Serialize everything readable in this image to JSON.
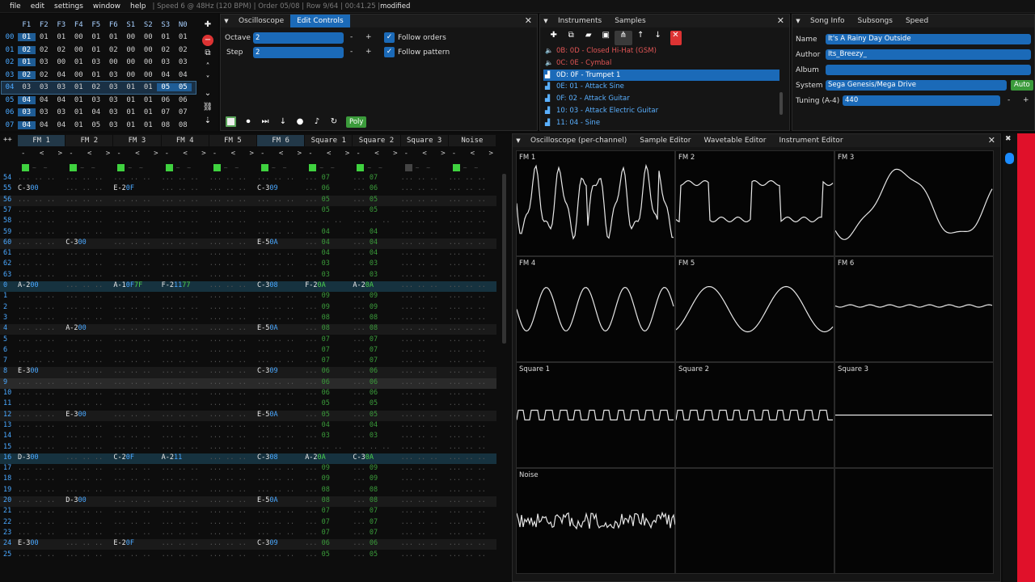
{
  "menu": {
    "file": "file",
    "edit": "edit",
    "settings": "settings",
    "window": "window",
    "help": "help",
    "status": "| Speed 6 @ 48Hz (120 BPM) | Order 05/08 | Row 9/64 | 00:41.25 |",
    "modified": "modified"
  },
  "orders": {
    "headers": [
      "F1",
      "F2",
      "F3",
      "F4",
      "F5",
      "F6",
      "S1",
      "S2",
      "S3",
      "N0"
    ],
    "rows": [
      {
        "n": "00",
        "v": [
          "01",
          "01",
          "01",
          "00",
          "01",
          "01",
          "00",
          "00",
          "01",
          "01"
        ]
      },
      {
        "n": "01",
        "v": [
          "02",
          "02",
          "02",
          "00",
          "01",
          "02",
          "00",
          "00",
          "02",
          "02"
        ]
      },
      {
        "n": "02",
        "v": [
          "01",
          "03",
          "00",
          "01",
          "03",
          "00",
          "00",
          "00",
          "03",
          "03"
        ]
      },
      {
        "n": "03",
        "v": [
          "02",
          "02",
          "04",
          "00",
          "01",
          "03",
          "00",
          "00",
          "04",
          "04"
        ]
      },
      {
        "n": "04",
        "v": [
          "03",
          "03",
          "03",
          "01",
          "02",
          "03",
          "01",
          "01",
          "05",
          "05"
        ]
      },
      {
        "n": "05",
        "v": [
          "04",
          "04",
          "04",
          "01",
          "03",
          "03",
          "01",
          "01",
          "06",
          "06"
        ]
      },
      {
        "n": "06",
        "v": [
          "03",
          "03",
          "03",
          "01",
          "04",
          "03",
          "01",
          "01",
          "07",
          "07"
        ]
      },
      {
        "n": "07",
        "v": [
          "04",
          "04",
          "04",
          "01",
          "05",
          "03",
          "01",
          "01",
          "08",
          "08"
        ]
      }
    ]
  },
  "edit": {
    "tab1": "Oscilloscope",
    "tab2": "Edit Controls",
    "octave_label": "Octave",
    "octave": "2",
    "step_label": "Step",
    "step": "2",
    "minus": "-",
    "plus": "+",
    "follow_orders": "Follow orders",
    "follow_pattern": "Follow pattern",
    "poly": "Poly"
  },
  "instruments": {
    "tab1": "Instruments",
    "tab2": "Samples",
    "items": [
      {
        "label": "0B: 0D - Closed Hi-Hat (GSM)",
        "kind": "red"
      },
      {
        "label": "0C: 0E - Cymbal",
        "kind": "red"
      },
      {
        "label": "0D: 0F - Trumpet 1",
        "kind": "sel"
      },
      {
        "label": "0E: 01 - Attack Sine",
        "kind": "blue"
      },
      {
        "label": "0F: 02 - Attack Guitar",
        "kind": "blue"
      },
      {
        "label": "10: 03 - Attack Electric Guitar",
        "kind": "blue"
      },
      {
        "label": "11: 04 - Sine",
        "kind": "blue"
      }
    ]
  },
  "song": {
    "tab1": "Song Info",
    "tab2": "Subsongs",
    "tab3": "Speed",
    "name_label": "Name",
    "name": "It's A Rainy Day Outside",
    "author_label": "Author",
    "author": "Its_Breezy_",
    "album_label": "Album",
    "album": "",
    "system_label": "System",
    "system": "Sega Genesis/Mega Drive",
    "auto": "Auto",
    "tuning_label": "Tuning (A-4)",
    "tuning": "440"
  },
  "pattern": {
    "channels": [
      "FM 1",
      "FM 2",
      "FM 3",
      "FM 4",
      "FM 5",
      "FM 6",
      "Square 1",
      "Square 2",
      "Square 3",
      "Noise"
    ],
    "corner": "++",
    "ctl": "- < >"
  },
  "osc": {
    "tab1": "Oscilloscope (per-channel)",
    "tab2": "Sample Editor",
    "tab3": "Wavetable Editor",
    "tab4": "Instrument Editor",
    "labels": [
      "FM 1",
      "FM 2",
      "FM 3",
      "FM 4",
      "FM 5",
      "FM 6",
      "Square 1",
      "Square 2",
      "Square 3",
      "Noise",
      "",
      ""
    ]
  },
  "colors": {
    "accent": "#1b6ab8",
    "green": "#3b9b3b",
    "red": "#e0112a",
    "rownum": "#4aa8ff"
  }
}
